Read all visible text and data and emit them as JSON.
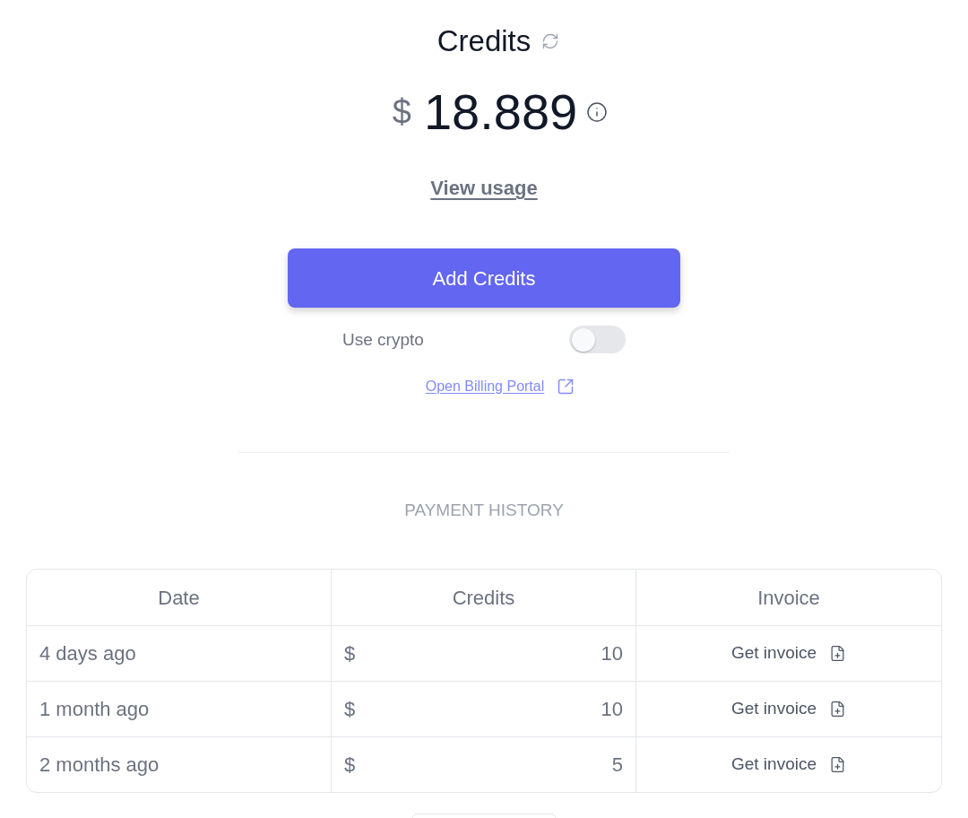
{
  "header": {
    "title": "Credits"
  },
  "balance": {
    "currency": "$",
    "amount": "18.889"
  },
  "view_usage": "View usage",
  "add_credits_button": "Add Credits",
  "crypto_toggle": {
    "label": "Use crypto",
    "on": false
  },
  "billing_portal_link": "Open Billing Portal",
  "payment_history": {
    "title": "PAYMENT HISTORY",
    "columns": [
      "Date",
      "Credits",
      "Invoice"
    ],
    "rows": [
      {
        "date": "4 days ago",
        "currency": "$",
        "credits": "10",
        "invoice": "Get invoice"
      },
      {
        "date": "1 month ago",
        "currency": "$",
        "credits": "10",
        "invoice": "Get invoice"
      },
      {
        "date": "2 months ago",
        "currency": "$",
        "credits": "5",
        "invoice": "Get invoice"
      }
    ]
  }
}
